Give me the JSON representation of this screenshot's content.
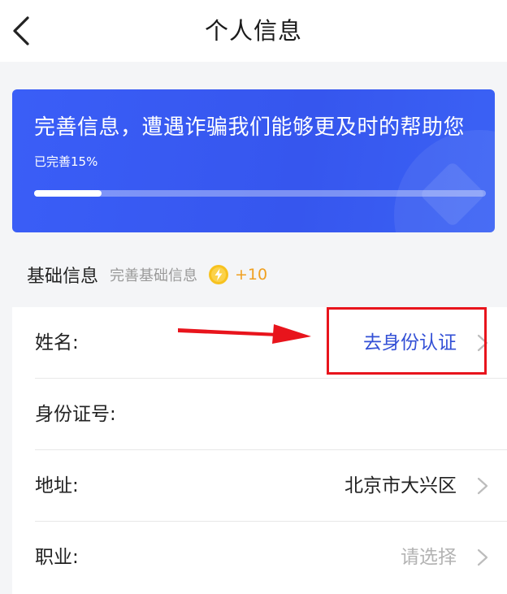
{
  "header": {
    "title": "个人信息",
    "back_icon": "chevron-left-icon"
  },
  "banner": {
    "title": "完善信息，遭遇诈骗我们能够更及时的帮助您",
    "progress_label": "已完善15%",
    "progress_fraction": 0.15,
    "color": "#3a5ef7"
  },
  "section": {
    "title": "基础信息",
    "subtitle": "完善基础信息",
    "reward_icon": "lightning-coin-icon",
    "reward": "+10",
    "reward_color": "#f0a020"
  },
  "fields": [
    {
      "label": "姓名:",
      "value": "去身份认证",
      "style": "link",
      "chevron": true
    },
    {
      "label": "身份证号:",
      "value": "",
      "style": "normal",
      "chevron": false
    },
    {
      "label": "地址:",
      "value": "北京市大兴区",
      "style": "normal",
      "chevron": true
    },
    {
      "label": "职业:",
      "value": "请选择",
      "style": "placeholder",
      "chevron": true
    }
  ],
  "annotation": {
    "color": "#e8141c",
    "shapes": [
      "red-arrow",
      "red-highlight-box"
    ]
  }
}
